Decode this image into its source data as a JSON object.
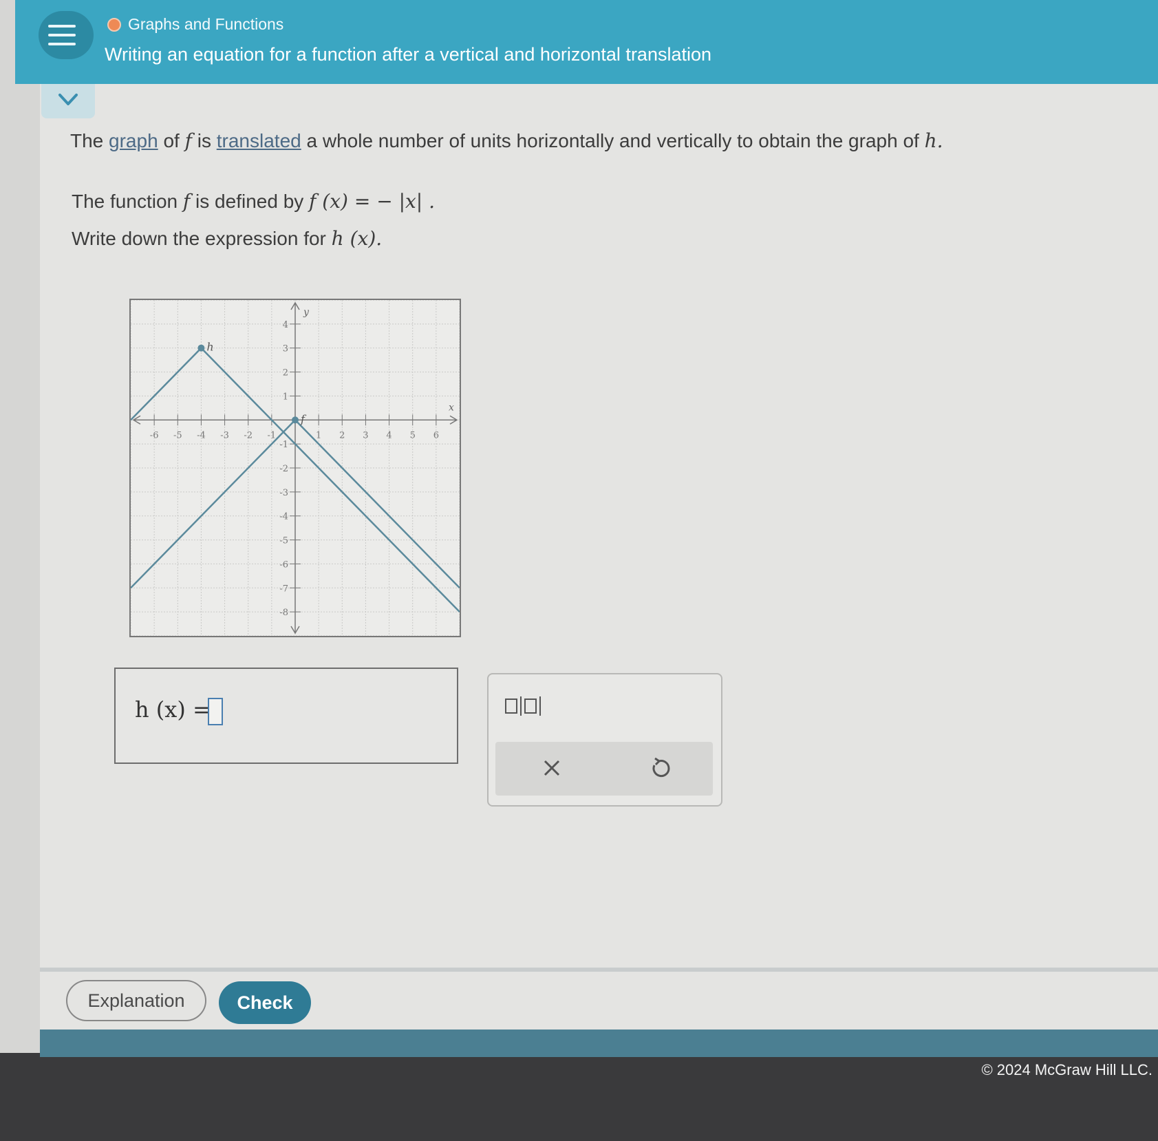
{
  "header": {
    "topic": "Graphs and Functions",
    "title": "Writing an equation for a function after a vertical and horizontal translation"
  },
  "question": {
    "line1": {
      "the": "The",
      "graph_link": "graph",
      "of": "of",
      "f": "f",
      "is": "is",
      "translated_link": "translated",
      "rest": "a whole number of units horizontally and vertically to obtain the graph of",
      "h": "h."
    },
    "line2": {
      "text": "The function",
      "f": "f",
      "is_defined_by": "is defined by",
      "equation": "f (x) = − |x| ."
    },
    "line3": {
      "text": "Write down the expression for",
      "expr": "h (x)."
    }
  },
  "chart_data": {
    "type": "line",
    "x_range": [
      -7,
      7
    ],
    "y_range": [
      -9,
      5
    ],
    "x_ticks": [
      -6,
      -5,
      -4,
      -3,
      -2,
      -1,
      1,
      2,
      3,
      4,
      5,
      6
    ],
    "y_ticks": [
      4,
      3,
      2,
      1,
      -1,
      -2,
      -3,
      -4,
      -5,
      -6,
      -7,
      -8
    ],
    "x_tick_labels": [
      "-6",
      "-5",
      "-4",
      "-3",
      "-2",
      "-1",
      "1",
      "2",
      "3",
      "4",
      "5",
      "6"
    ],
    "y_tick_labels": [
      "4",
      "3",
      "2",
      "1",
      "-1",
      "-2",
      "-3",
      "-4",
      "-5",
      "-6",
      "-7",
      "-8"
    ],
    "xlabel": "x",
    "ylabel": "y",
    "grid": true,
    "series": [
      {
        "name": "h",
        "vertex": [
          -4,
          3
        ],
        "points": [
          [
            -7,
            0
          ],
          [
            -4,
            3
          ],
          [
            7,
            -8
          ]
        ]
      },
      {
        "name": "f",
        "vertex": [
          0,
          0
        ],
        "points": [
          [
            -7,
            -7
          ],
          [
            0,
            0
          ],
          [
            7,
            -7
          ]
        ]
      }
    ],
    "color": "#5b8a9c"
  },
  "answer": {
    "label": "h (x) ="
  },
  "tools": {
    "abs_value_icon": "absolute-value-template",
    "clear_icon": "close-icon",
    "undo_icon": "undo-icon"
  },
  "buttons": {
    "explanation": "Explanation",
    "check": "Check"
  },
  "footer": {
    "copyright": "© 2024 McGraw Hill LLC."
  },
  "colors": {
    "header": "#3ba6c2",
    "accent_button": "#2f7b95",
    "topic_dot": "#ee8a55"
  }
}
